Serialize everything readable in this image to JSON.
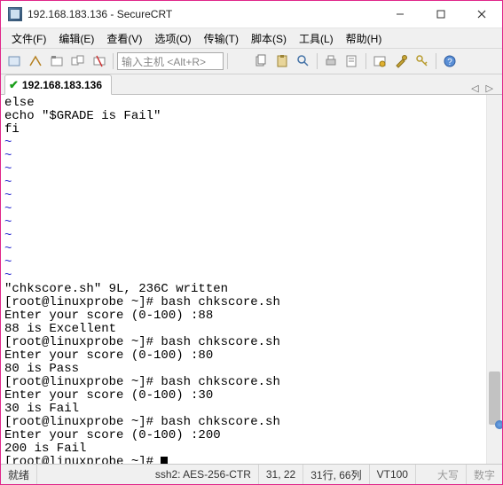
{
  "window": {
    "title": "192.168.183.136 - SecureCRT"
  },
  "menu": {
    "file": "文件(F)",
    "edit": "编辑(E)",
    "view": "查看(V)",
    "options": "选项(O)",
    "transfer": "传输(T)",
    "script": "脚本(S)",
    "tools": "工具(L)",
    "help": "帮助(H)"
  },
  "toolbar": {
    "host_placeholder": "输入主机 <Alt+R>"
  },
  "tab": {
    "label": "192.168.183.136"
  },
  "terminal": {
    "lines": [
      "else",
      "echo \"$GRADE is Fail\"",
      "fi",
      "~",
      "~",
      "~",
      "~",
      "~",
      "~",
      "~",
      "~",
      "~",
      "~",
      "~",
      "\"chkscore.sh\" 9L, 236C written",
      "[root@linuxprobe ~]# bash chkscore.sh",
      "Enter your score (0-100) :88",
      "88 is Excellent",
      "[root@linuxprobe ~]# bash chkscore.sh",
      "Enter your score (0-100) :80",
      "80 is Pass",
      "[root@linuxprobe ~]# bash chkscore.sh",
      "Enter your score (0-100) :30",
      "30 is Fail",
      "[root@linuxprobe ~]# bash chkscore.sh",
      "Enter your score (0-100) :200",
      "200 is Fail",
      "[root@linuxprobe ~]# "
    ]
  },
  "status": {
    "ready": "就绪",
    "cipher": "ssh2: AES-256-CTR",
    "cursor": "31, 22",
    "size": "31行, 66列",
    "emulation": "VT100",
    "caps": "大写",
    "num": "数字"
  }
}
